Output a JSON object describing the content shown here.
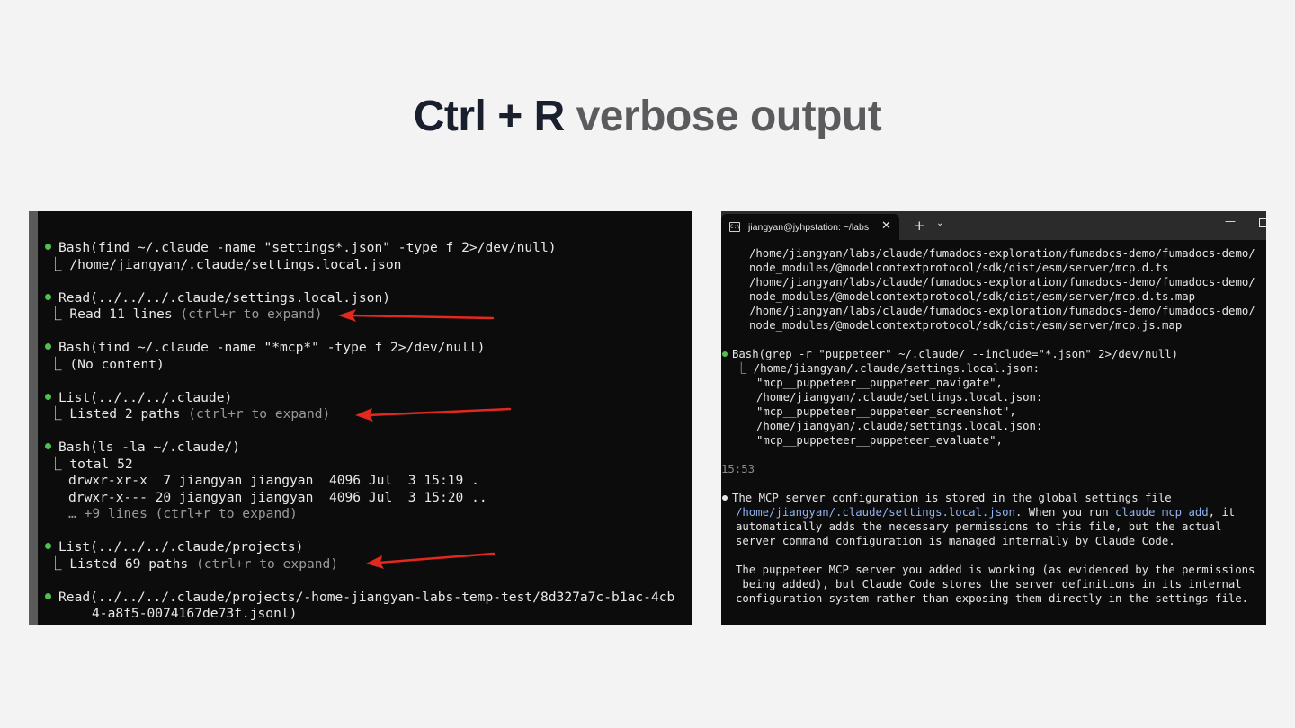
{
  "title": {
    "strong": "Ctrl + R",
    "light": "verbose output"
  },
  "left_terminal": {
    "entries": [
      {
        "cmd": "Bash(find ~/.claude -name \"settings*.json\" -type f 2>/dev/null)",
        "out": [
          "⎿ /home/jiangyan/.claude/settings.local.json"
        ]
      },
      {
        "cmd": "Read(../../../.claude/settings.local.json)",
        "out_main": "⎿ Read 11 lines",
        "out_dim": " (ctrl+r to expand)"
      },
      {
        "cmd": "Bash(find ~/.claude -name \"*mcp*\" -type f 2>/dev/null)",
        "out": [
          "⎿ (No content)"
        ]
      },
      {
        "cmd": "List(../../../.claude)",
        "out_main": "⎿ Listed 2 paths",
        "out_dim": " (ctrl+r to expand)"
      },
      {
        "cmd": "Bash(ls -la ~/.claude/)",
        "out": [
          "⎿ total 52",
          "drwxr-xr-x  7 jiangyan jiangyan  4096 Jul  3 15:19 .",
          "drwxr-x--- 20 jiangyan jiangyan  4096 Jul  3 15:20 .."
        ],
        "out_more": "… +9 lines (ctrl+r to expand)"
      },
      {
        "cmd": "List(../../../.claude/projects)",
        "out_main": "⎿ Listed 69 paths",
        "out_dim": " (ctrl+r to expand)"
      },
      {
        "cmd": "Read(../../../.claude/projects/-home-jiangyan-labs-temp-test/8d327a7c-b1ac-4cb",
        "cmd_cont": "4-a8f5-0074167de73f.jsonl)"
      }
    ]
  },
  "right_terminal": {
    "tab_title": "jiangyan@jyhpstation: ~/labs",
    "tab_icon": "C:\\",
    "icons": {
      "close": "✕",
      "new_tab": "+",
      "dropdown": "⌄",
      "minimize": "—"
    },
    "path_lines": [
      "/home/jiangyan/labs/claude/fumadocs-exploration/fumadocs-demo/fumadocs-demo/",
      "node_modules/@modelcontextprotocol/sdk/dist/esm/server/mcp.d.ts",
      "/home/jiangyan/labs/claude/fumadocs-exploration/fumadocs-demo/fumadocs-demo/",
      "node_modules/@modelcontextprotocol/sdk/dist/esm/server/mcp.d.ts.map",
      "/home/jiangyan/labs/claude/fumadocs-exploration/fumadocs-demo/fumadocs-demo/",
      "node_modules/@modelcontextprotocol/sdk/dist/esm/server/mcp.js.map"
    ],
    "grep_cmd": "Bash(grep -r \"puppeteer\" ~/.claude/ --include=\"*.json\" 2>/dev/null)",
    "grep_out": [
      "⎿ /home/jiangyan/.claude/settings.local.json:",
      "\"mcp__puppeteer__puppeteer_navigate\",",
      "/home/jiangyan/.claude/settings.local.json:",
      "\"mcp__puppeteer__puppeteer_screenshot\",",
      "/home/jiangyan/.claude/settings.local.json:",
      "\"mcp__puppeteer__puppeteer_evaluate\","
    ],
    "timestamp": "15:53",
    "msg1": {
      "l1": "The MCP server configuration is stored in the global settings file",
      "l2_link": "/home/jiangyan/.claude/settings.local.json",
      "l2_mid": ". When you run ",
      "l2_cmd": "claude mcp add",
      "l2_end": ", it",
      "l3": "automatically adds the necessary permissions to this file, but the actual",
      "l4": "server command configuration is managed internally by Claude Code."
    },
    "msg2": [
      "The puppeteer MCP server you added is working (as evidenced by the permissions",
      " being added), but Claude Code stores the server definitions in its internal",
      "configuration system rather than exposing them directly in the settings file."
    ]
  },
  "colors": {
    "background": "#f3f3f4",
    "title_strong": "#1a1f2e",
    "title_light": "#5b5b5e",
    "terminal_bg": "#0c0c0c",
    "bullet_green": "#4ec14e",
    "arrow_red": "#e3281d",
    "link_blue": "#8fb4f0"
  }
}
